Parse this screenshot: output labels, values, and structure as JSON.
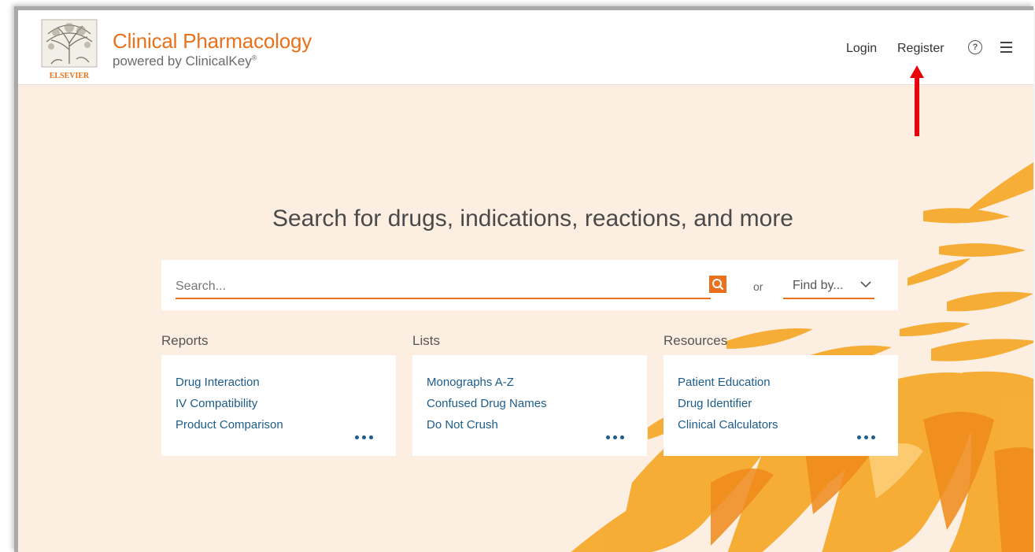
{
  "header": {
    "brand_title": "Clinical Pharmacology",
    "brand_sub": "powered by ClinicalKey",
    "brand_sub_mark": "®",
    "logo_text": "ELSEVIER",
    "nav_login": "Login",
    "nav_register": "Register",
    "help_icon_glyph": "?"
  },
  "main": {
    "headline": "Search for drugs, indications, reactions, and more",
    "search": {
      "placeholder": "Search...",
      "or_label": "or",
      "find_by_label": "Find by..."
    },
    "sections": [
      {
        "title": "Reports",
        "links": [
          "Drug Interaction",
          "IV Compatibility",
          "Product Comparison"
        ]
      },
      {
        "title": "Lists",
        "links": [
          "Monographs A-Z",
          "Confused Drug Names",
          "Do Not Crush"
        ]
      },
      {
        "title": "Resources",
        "links": [
          "Patient Education",
          "Drug Identifier",
          "Clinical Calculators"
        ]
      }
    ]
  },
  "colors": {
    "accent": "#e9711c",
    "link": "#1d5c8a",
    "background": "#fdeee2",
    "annotation_arrow": "#e8000b"
  },
  "icons": [
    "elsevier-logo",
    "help-icon",
    "hamburger-menu-icon",
    "search-icon",
    "chevron-down-icon",
    "more-dots-icon"
  ]
}
